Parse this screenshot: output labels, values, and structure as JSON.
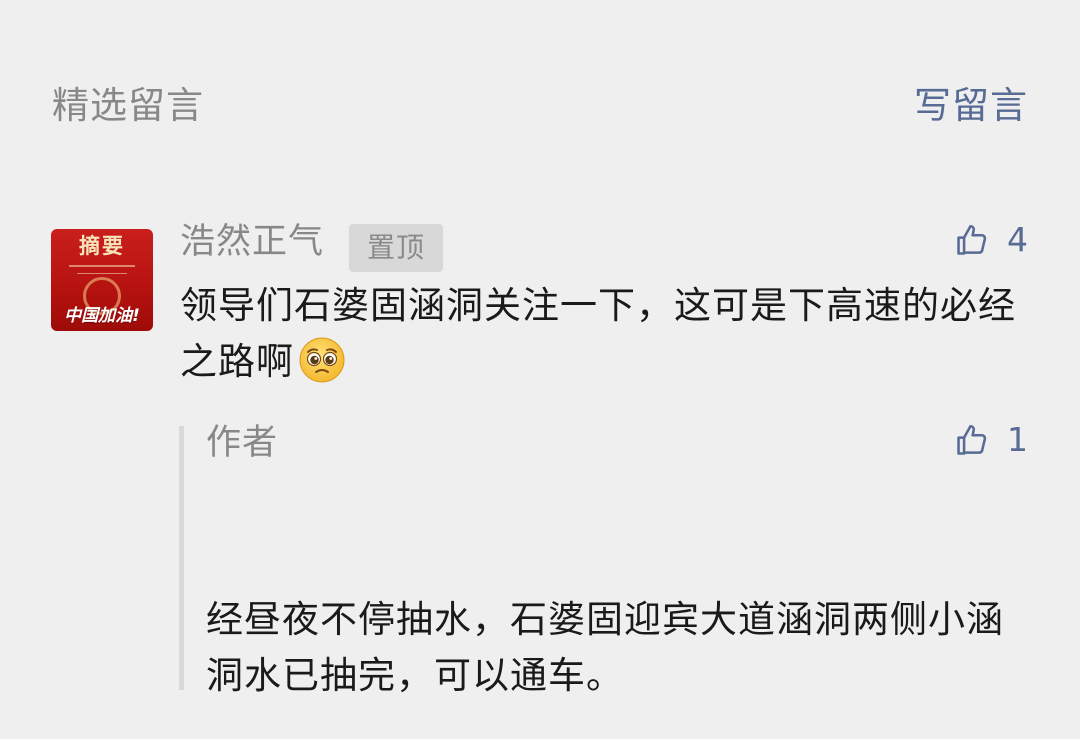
{
  "header": {
    "section_title": "精选留言",
    "write_comment": "写留言"
  },
  "comment": {
    "avatar": {
      "top_text": "摘要",
      "bottom_text": "中国加油!"
    },
    "nickname": "浩然正气",
    "pin_badge": "置顶",
    "like_count": "4",
    "text": "领导们石婆固涵洞关注一下，这可是下高速的必经之路啊",
    "emoji": "pleading-face-emoji"
  },
  "reply": {
    "author": "作者",
    "like_count": "1",
    "text": "经昼夜不停抽水，石婆固迎宾大道涵洞两侧小涵洞水已抽完，可以通车。"
  },
  "colors": {
    "background": "#efefef",
    "link_blue": "#576b95",
    "meta_gray": "#888888",
    "text_dark": "#1a1a1a"
  }
}
